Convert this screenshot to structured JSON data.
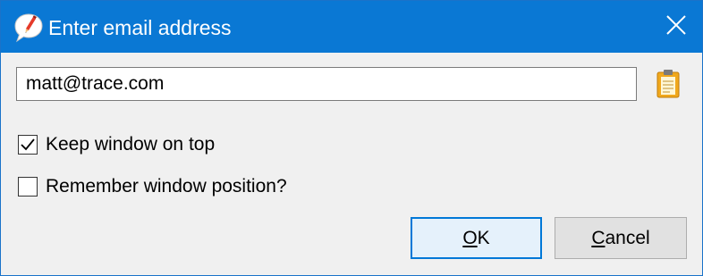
{
  "window": {
    "title": "Enter email address",
    "app_icon": "feedback-bubble-pencil-icon",
    "close_icon": "close-icon"
  },
  "email": {
    "value": "matt@trace.com",
    "paste_icon": "clipboard-icon"
  },
  "options": {
    "keep_on_top": {
      "label": "Keep window on top",
      "checked": true
    },
    "remember_position": {
      "label": "Remember window position?",
      "checked": false
    }
  },
  "buttons": {
    "ok": {
      "accel": "O",
      "rest": "K"
    },
    "cancel": {
      "accel": "C",
      "rest": "ancel"
    }
  },
  "colors": {
    "titlebar": "#0a78d4",
    "title_text": "#ffffff",
    "body": "#f0f0f0",
    "focus_border": "#0078d7"
  }
}
